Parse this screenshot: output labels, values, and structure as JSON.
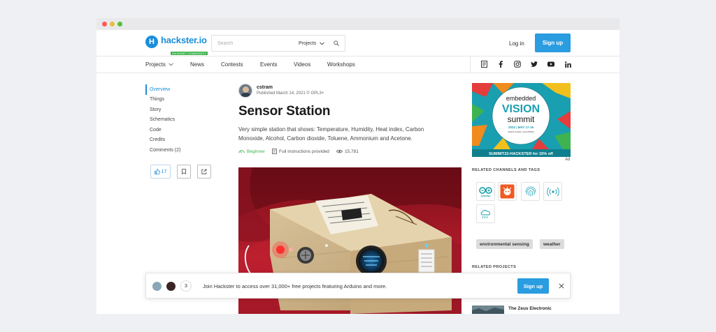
{
  "site": {
    "name": "hackster.io",
    "tagline": "AN AVNET COMMUNITY"
  },
  "search": {
    "placeholder": "Search",
    "scope": "Projects"
  },
  "auth": {
    "login": "Log in",
    "signup": "Sign up"
  },
  "nav": {
    "items": [
      "Projects",
      "News",
      "Contests",
      "Events",
      "Videos",
      "Workshops"
    ],
    "social": [
      "news-icon",
      "facebook-icon",
      "instagram-icon",
      "twitter-icon",
      "youtube-icon",
      "linkedin-icon"
    ]
  },
  "toc": {
    "items": [
      "Overview",
      "Things",
      "Story",
      "Schematics",
      "Code",
      "Credits",
      "Comments (2)"
    ],
    "active": "Overview"
  },
  "actions": {
    "likes": "17"
  },
  "project": {
    "author": "cstram",
    "published": "Published March 14, 2021 © GPL3+",
    "title": "Sensor Station",
    "description": "Very simple station that shows: Temperature, Humidity, Heat index, Carbon Monoxide, Alcohol, Carbon dioxide, Toluene, Ammonium and Acetone.",
    "difficulty": "Beginner",
    "instructions": "Full instructions provided",
    "views": "15,781"
  },
  "ad": {
    "line1": "embedded",
    "line2": "VISION",
    "line3": "summit",
    "dates": "2022 | MAY 17-19",
    "location": "SANTA CLARA, CALIFORNIA",
    "promo": "SUMMIT22-HACKSTER for 15% off",
    "label": "Ad"
  },
  "sidebar": {
    "channels_title": "RELATED CHANNELS AND TAGS",
    "channel_logo_text": "ARDUINO",
    "tags": [
      "environmental sensing",
      "weather"
    ],
    "related_title": "RELATED PROJECTS",
    "related_project": "The Zeus Electronic"
  },
  "banner": {
    "count": "3",
    "text": "Join Hackster to access over 31,000+ free projects featuring Arduino and more.",
    "signup": "Sign up"
  },
  "colors": {
    "brand": "#1a8edb",
    "button": "#2a9ce0",
    "success": "#3fb34f"
  }
}
